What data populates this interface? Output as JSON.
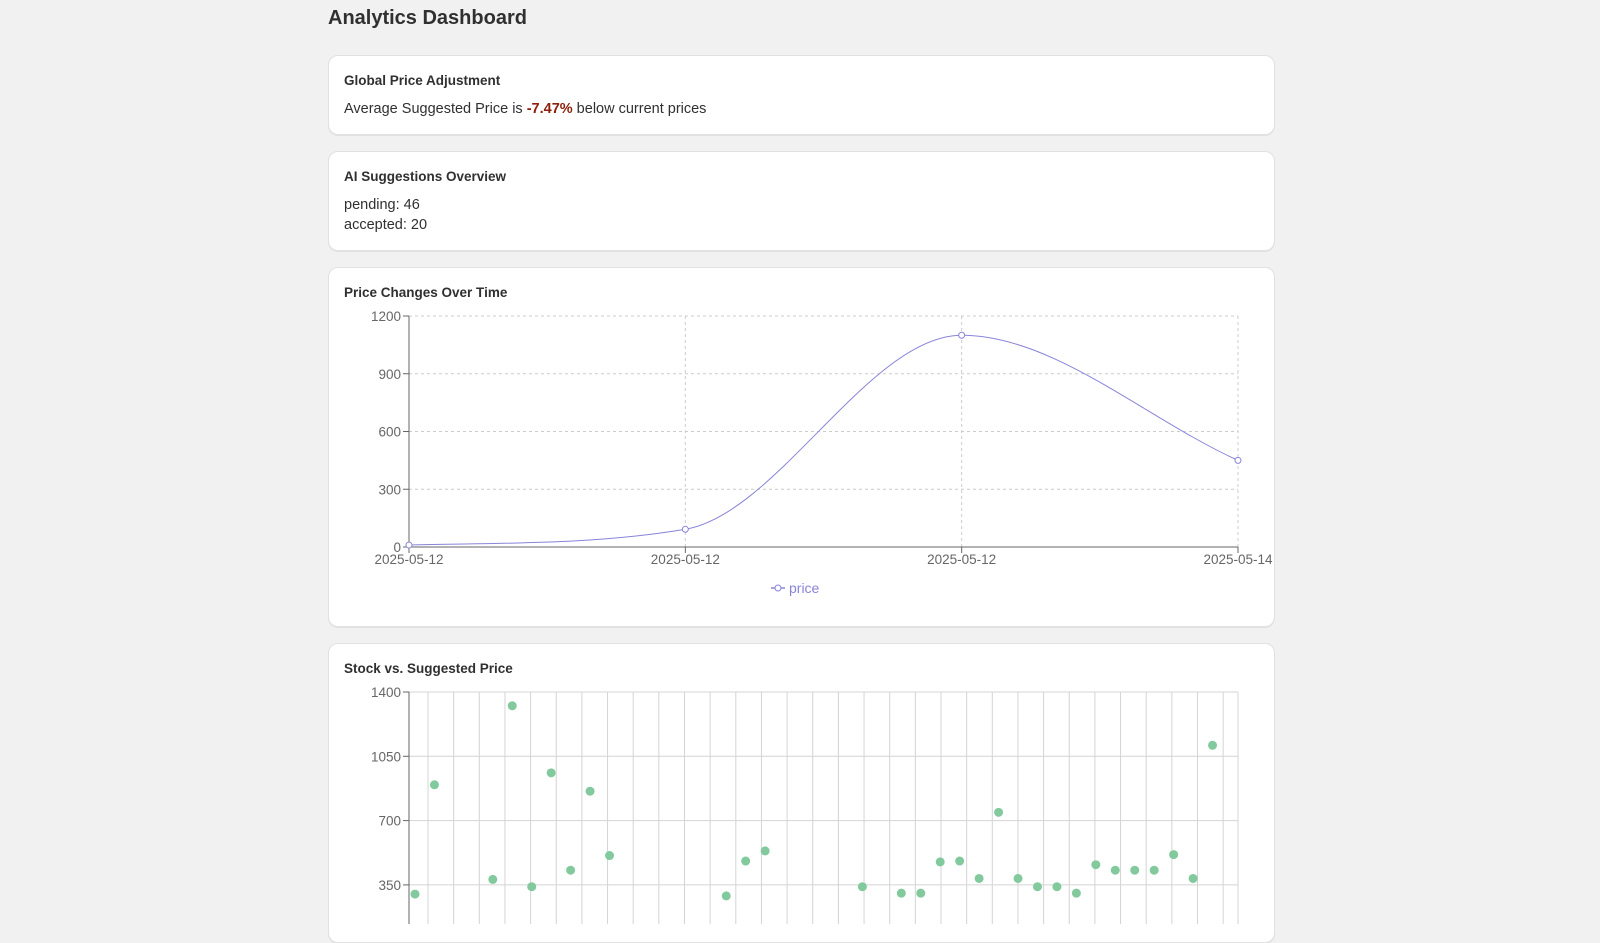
{
  "page": {
    "title": "Analytics Dashboard"
  },
  "adjustment": {
    "title": "Global Price Adjustment",
    "prefix": "Average Suggested Price is ",
    "percent": "-7.47%",
    "suffix": " below current prices"
  },
  "ai_overview": {
    "title": "AI Suggestions Overview",
    "pending": "pending: 46",
    "accepted": "accepted: 20"
  },
  "price_chart": {
    "card_title": "Price Changes Over Time"
  },
  "stock_chart": {
    "card_title": "Stock vs. Suggested Price"
  },
  "colors": {
    "line": "#8884d8",
    "scatter": "#82ca9d",
    "negative": "#8e1f0b"
  },
  "chart_data": [
    {
      "type": "line",
      "title": "Price Changes Over Time",
      "x": [
        "2025-05-12",
        "2025-05-12",
        "2025-05-12",
        "2025-05-14"
      ],
      "series": [
        {
          "name": "price",
          "values": [
            10,
            92,
            1100,
            450
          ]
        }
      ],
      "yticks": [
        0,
        300,
        600,
        900,
        1200
      ],
      "ylim": [
        0,
        1200
      ],
      "xlabel": "",
      "ylabel": "",
      "grid": true,
      "legend": "bottom-center"
    },
    {
      "type": "scatter",
      "title": "Stock vs. Suggested Price",
      "yticks": [
        350,
        700,
        1050,
        1400
      ],
      "ylim": [
        0,
        1400
      ],
      "xlabel": "",
      "ylabel": "",
      "grid": true,
      "n_categories": 33,
      "points": [
        [
          0,
          300
        ],
        [
          1,
          895
        ],
        [
          4,
          380
        ],
        [
          5,
          1325
        ],
        [
          6,
          340
        ],
        [
          7,
          960
        ],
        [
          8,
          430
        ],
        [
          9,
          860
        ],
        [
          10,
          510
        ],
        [
          16,
          290
        ],
        [
          17,
          480
        ],
        [
          18,
          535
        ],
        [
          23,
          340
        ],
        [
          25,
          305
        ],
        [
          26,
          305
        ],
        [
          27,
          475
        ],
        [
          28,
          480
        ],
        [
          29,
          385
        ],
        [
          30,
          745
        ],
        [
          31,
          385
        ],
        [
          32,
          340
        ],
        [
          33,
          340
        ],
        [
          34,
          305
        ],
        [
          35,
          460
        ],
        [
          36,
          430
        ],
        [
          37,
          430
        ],
        [
          38,
          430
        ],
        [
          39,
          515
        ],
        [
          40,
          385
        ],
        [
          41,
          1110
        ]
      ]
    }
  ]
}
